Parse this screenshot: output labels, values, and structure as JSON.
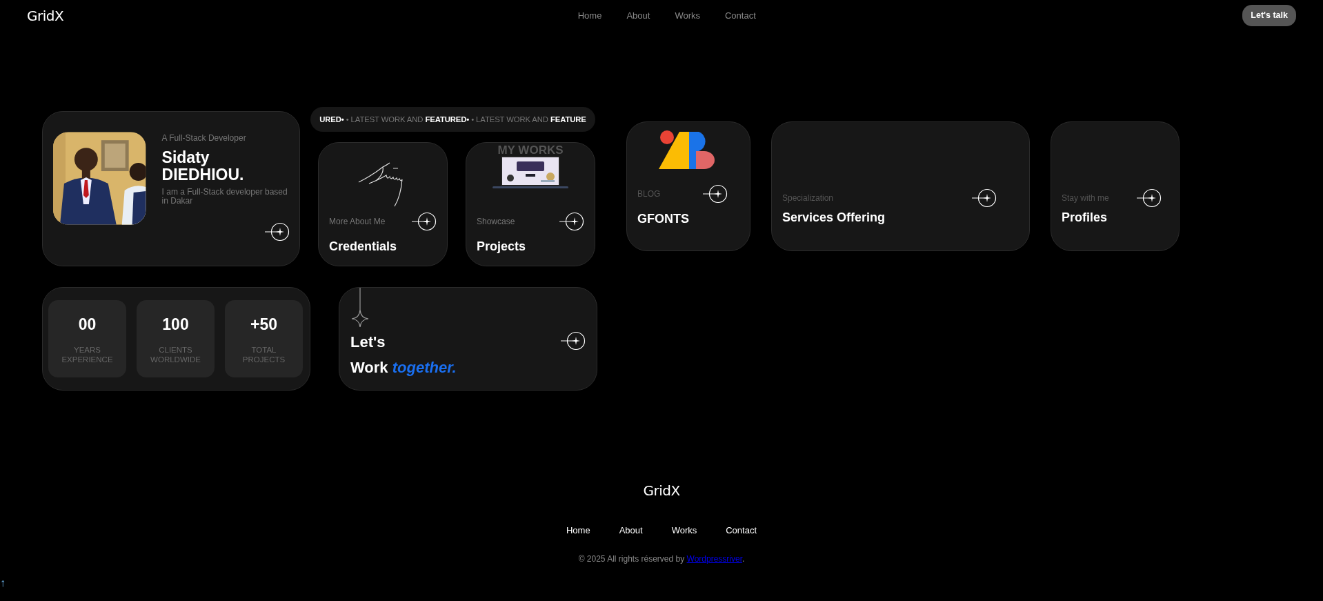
{
  "header": {
    "logo": "GridX",
    "nav": [
      {
        "label": "Home"
      },
      {
        "label": "About"
      },
      {
        "label": "Works"
      },
      {
        "label": "Contact"
      }
    ],
    "cta": "Let's talk"
  },
  "profile": {
    "subtitle": "A Full-Stack Developer",
    "name": "Sidaty DIEDHIOU.",
    "bio": "I am a Full-Stack developer based in Dakar"
  },
  "marquee": "**URED•** • LATEST WORK AND **FEATURED•** • LATEST WORK AND **FEATURE**",
  "cards": [
    {
      "kind": "signature",
      "label": "More About Me",
      "title": "Credentials"
    },
    {
      "kind": "works",
      "heading": "MY WORKS",
      "label": "Showcase",
      "title": "Projects"
    }
  ],
  "side_cards": [
    {
      "kind": "logo",
      "label": "BLOG",
      "title": "GFONTS"
    },
    {
      "kind": "plain",
      "label": "Specialization",
      "title": "Services Offering"
    },
    {
      "kind": "plain",
      "label": "Stay with me",
      "title": "Profiles"
    }
  ],
  "stats": [
    {
      "value": "00",
      "label": "YEARS EXPERIENCE"
    },
    {
      "value": "100",
      "label": "CLIENTS WORLDWIDE"
    },
    {
      "value": "+50",
      "label": "TOTAL PROJECTS"
    }
  ],
  "cta_card": {
    "line1": "Let's",
    "line2": "Work *together.*"
  },
  "footer": {
    "logo": "GridX",
    "nav": [
      {
        "label": "Home"
      },
      {
        "label": "About"
      },
      {
        "label": "Works"
      },
      {
        "label": "Contact"
      }
    ],
    "copyright": "© 2025 All rights réserved by",
    "link": "Wordpressriver",
    "end": "."
  },
  "back_to_top": "↑"
}
